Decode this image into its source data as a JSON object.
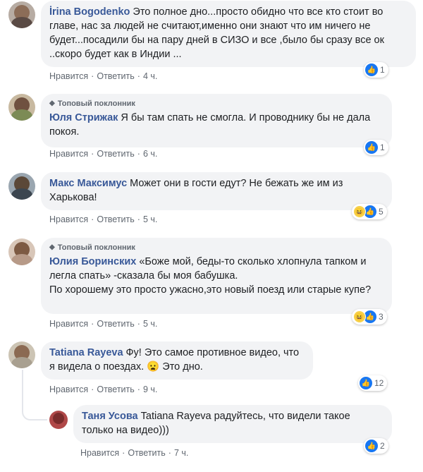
{
  "colors": {
    "like": "#1877f2",
    "haha": "#f7d046",
    "author": "#385898",
    "bubble": "#f2f3f5"
  },
  "actions": {
    "like": "Нравится",
    "reply": "Ответить"
  },
  "comments": [
    {
      "author": "İrina Bogodenko",
      "text": "Это полное дно...просто обидно что все кто стоит во главе, нас за людей не считают,именно они знают что им ничего не будет...посадили бы на пару дней в СИЗО и все ,было бы сразу все ок ..скоро будет как в Индии ...",
      "time": "4 ч.",
      "reactions": [
        "like-icon"
      ],
      "reaction_count": "1"
    },
    {
      "badge": "Топовый поклонник",
      "author": "Юля Стрижак",
      "text": "Я бы там спать не смогла. И проводнику бы не дала покоя.",
      "time": "6 ч.",
      "reactions": [
        "like-icon"
      ],
      "reaction_count": "1"
    },
    {
      "author": "Макс Максимус",
      "text": "Может они в гости едут? Не бежать же им из Харькова!",
      "time": "5 ч.",
      "reactions": [
        "haha-icon",
        "like-icon"
      ],
      "reaction_count": "5"
    },
    {
      "badge": "Топовый поклонник",
      "author": "Юлия Боринских",
      "text": "«Боже мой, беды-то сколько хлопнула тапком и легла спать» -сказала бы моя бабушка.",
      "text2": "По хорошему это просто ужасно,это новый поезд или старые купе?",
      "time": "5 ч.",
      "reactions": [
        "haha-icon",
        "like-icon"
      ],
      "reaction_count": "3"
    },
    {
      "author": "Tatiana Rayeva",
      "text": "Фу! Это самое противное видео, что я видела о поездах. 😦 Это дно.",
      "time": "9 ч.",
      "reactions": [
        "like-icon"
      ],
      "reaction_count": "12"
    },
    {
      "author": "Таня Усова",
      "text": "Tatiana Rayeva радуйтесь, что видели такое только на видео)))",
      "time": "7 ч.",
      "reactions": [
        "like-icon"
      ],
      "reaction_count": "2"
    }
  ]
}
